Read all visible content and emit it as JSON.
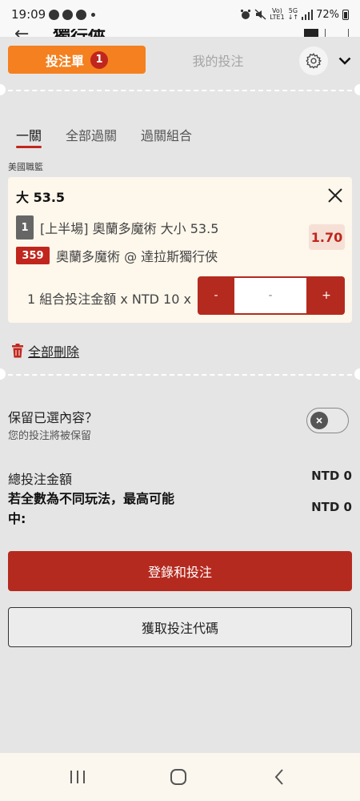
{
  "status_bar": {
    "time": "19:09",
    "network_top": "Vo)",
    "network_bottom": "LTE1",
    "signal_type_top": "5G",
    "signal_type_bottom": "↓↑",
    "battery": "72%"
  },
  "background_header": {
    "title": "獨行俠"
  },
  "top_bar": {
    "betslip_tab": "投注單",
    "betslip_count": "1",
    "mybets_tab": "我的投注",
    "icons": [
      "gear-icon",
      "chevron-down-icon"
    ]
  },
  "sub_tabs": [
    {
      "label": "一關",
      "active": true
    },
    {
      "label": "全部過關",
      "active": false
    },
    {
      "label": "過關組合",
      "active": false
    }
  ],
  "league": "美國職籃",
  "bet": {
    "selection": "大 53.5",
    "period_tag": "1",
    "market": "[上半場] 奧蘭多魔術 大小 53.5",
    "match_code": "359",
    "match": "奧蘭多魔術 @ 達拉斯獨行俠",
    "odds": "1.70",
    "stake_label": "1 組合投注金額 x NTD 10 x",
    "minus_label": "-",
    "stake_value": "-",
    "plus_label": "+"
  },
  "delete_all": "全部刪除",
  "keep_selection": {
    "title": "保留已選內容？",
    "subtitle": "您的投注將被保留",
    "enabled": false
  },
  "totals": {
    "total_label": "總投注金額",
    "total_value": "NTD 0",
    "max_win_label": "若全數為不同玩法，最高可能中:",
    "max_win_value": "NTD 0"
  },
  "buttons": {
    "login_bet": "登錄和投注",
    "get_code": "獲取投注代碼"
  },
  "colors": {
    "accent_orange": "#f4801f",
    "accent_red": "#b52a1f",
    "card_bg": "#fdf7ec",
    "sheet_bg": "#e5e5e5"
  }
}
